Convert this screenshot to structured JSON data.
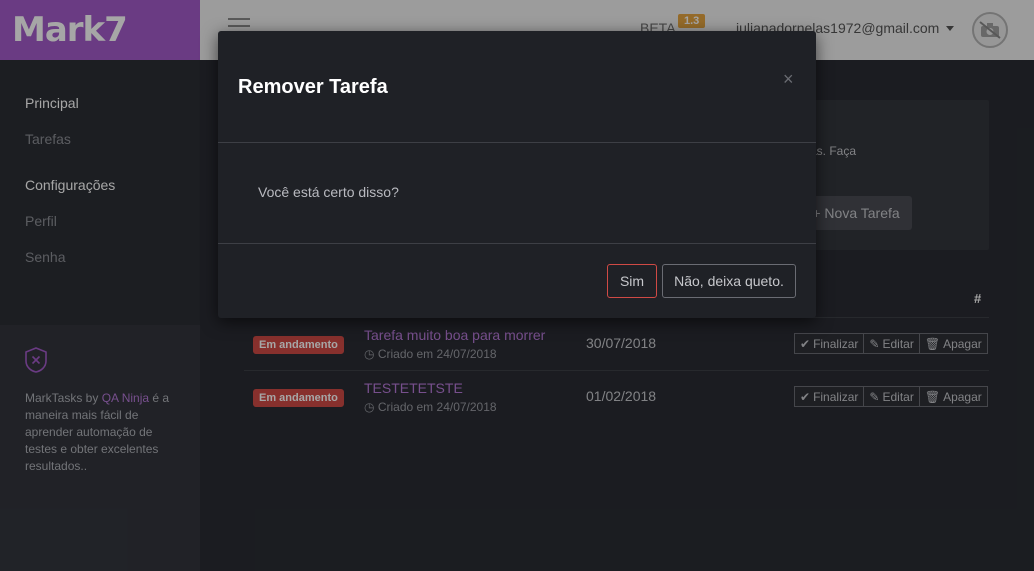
{
  "brand": {
    "logo_text": "Mark7",
    "accent": "#a35bc9"
  },
  "header": {
    "beta_label": "BETA",
    "version": "1.3",
    "user_email": "julianadornelas1972@gmail.com",
    "avatar_icon": "camera-off-icon"
  },
  "sidebar": {
    "sections": [
      {
        "title": "Principal",
        "items": [
          "Tarefas"
        ]
      },
      {
        "title": "Configurações",
        "items": [
          "Perfil",
          "Senha"
        ]
      }
    ],
    "promo": {
      "icon": "shield-x-icon",
      "prefix": "MarkTasks by ",
      "link": "QA Ninja",
      "suffix": " é a maneira mais fácil de aprender automação de testes e obter excelentes resultados.."
    }
  },
  "main": {
    "panel_text": "efas. Faça",
    "new_task_label": "Nova Tarefa",
    "table_hash": "#",
    "tasks": [
      {
        "status": "Em andamento",
        "title": "Tarefa muito boa para morrer",
        "created": "Criado em 24/07/2018",
        "date": "30/07/2018"
      },
      {
        "status": "Em andamento",
        "title": "TESTETETSTE",
        "created": "Criado em 24/07/2018",
        "date": "01/02/2018"
      }
    ],
    "actions": {
      "finish": "Finalizar",
      "edit": "Editar",
      "delete": "Apagar"
    },
    "status_color": "#d04a45"
  },
  "modal": {
    "title": "Remover Tarefa",
    "close_symbol": "×",
    "message": "Você está certo disso?",
    "confirm_label": "Sim",
    "cancel_label": "Não, deixa queto."
  }
}
